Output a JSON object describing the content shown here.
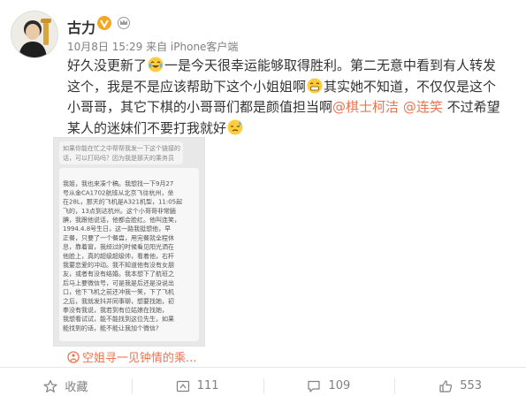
{
  "post": {
    "username": "古力",
    "meta": "10月8日 15:29 来自 iPhone客户端",
    "text_segments": [
      {
        "type": "text",
        "value": "好久没更新了"
      },
      {
        "type": "emoji",
        "value": "laugh-cry"
      },
      {
        "type": "text",
        "value": "一是今天很幸运能够取得胜利。第二无意中看到有人转发这个，我是不是应该帮助下这个小姐姐啊"
      },
      {
        "type": "emoji",
        "value": "grin"
      },
      {
        "type": "text",
        "value": "其实她不知道，不仅仅是这个小哥哥，其它下棋的小哥哥们都是颜值担当啊"
      },
      {
        "type": "mention",
        "value": "@棋士柯洁"
      },
      {
        "type": "text",
        "value": " "
      },
      {
        "type": "mention",
        "value": "@连笑"
      },
      {
        "type": "text",
        "value": " 不过希望某人的迷妹们不要打我就好"
      },
      {
        "type": "emoji",
        "value": "sweat"
      }
    ],
    "source_link": "空姐寻一见钟情的乘...",
    "image_text": [
      "如果你能在忙之中帮帮我发一下这个链接的",
      "话，可以打码吗？因为我是那天的乘务员",
      "",
      "我姐，我也来凑个稿。我想找一下9月27",
      "号从金CA1702航班从北京飞往杭州，坐",
      "在28L，那天的飞机是A321机型，11:05起",
      "飞的，13点到达杭州。这个小哥哥非常腼",
      "腆，我跟他说话，他都会脸红。他叫连笑，",
      "1994.4.8号生日，这一路我挺想他，早",
      "正餐，只要了一个餐盘，用完餐就全程休",
      "息，靠着窗，我经过的时候看见阳光洒在",
      "他脸上，真的超级超级帅，看着他，右杆",
      "我要恋爱的冲动。我不知道他有没有女朋",
      "友，或者有没有结婚。我本想下了航班之",
      "后马上要微信号，可是我是后还是没说出",
      "口，他下飞机之前还冲我一笑，下了飞机",
      "之后，我就发抖并同事聊，想要找她，初",
      "拳没有我说，我若到有位姑娘在找她，",
      "我想看试试，能不能找到这位先生，如果",
      "能找到的话，能不能让我加个微信?"
    ],
    "actions": [
      {
        "name": "favorite",
        "label": "收藏"
      },
      {
        "name": "repost",
        "label": "111"
      },
      {
        "name": "comment",
        "label": "109"
      },
      {
        "name": "like",
        "label": "553"
      }
    ]
  },
  "colors": {
    "mention": "#eb7350",
    "meta": "#808080",
    "vip": "#f5a623"
  }
}
